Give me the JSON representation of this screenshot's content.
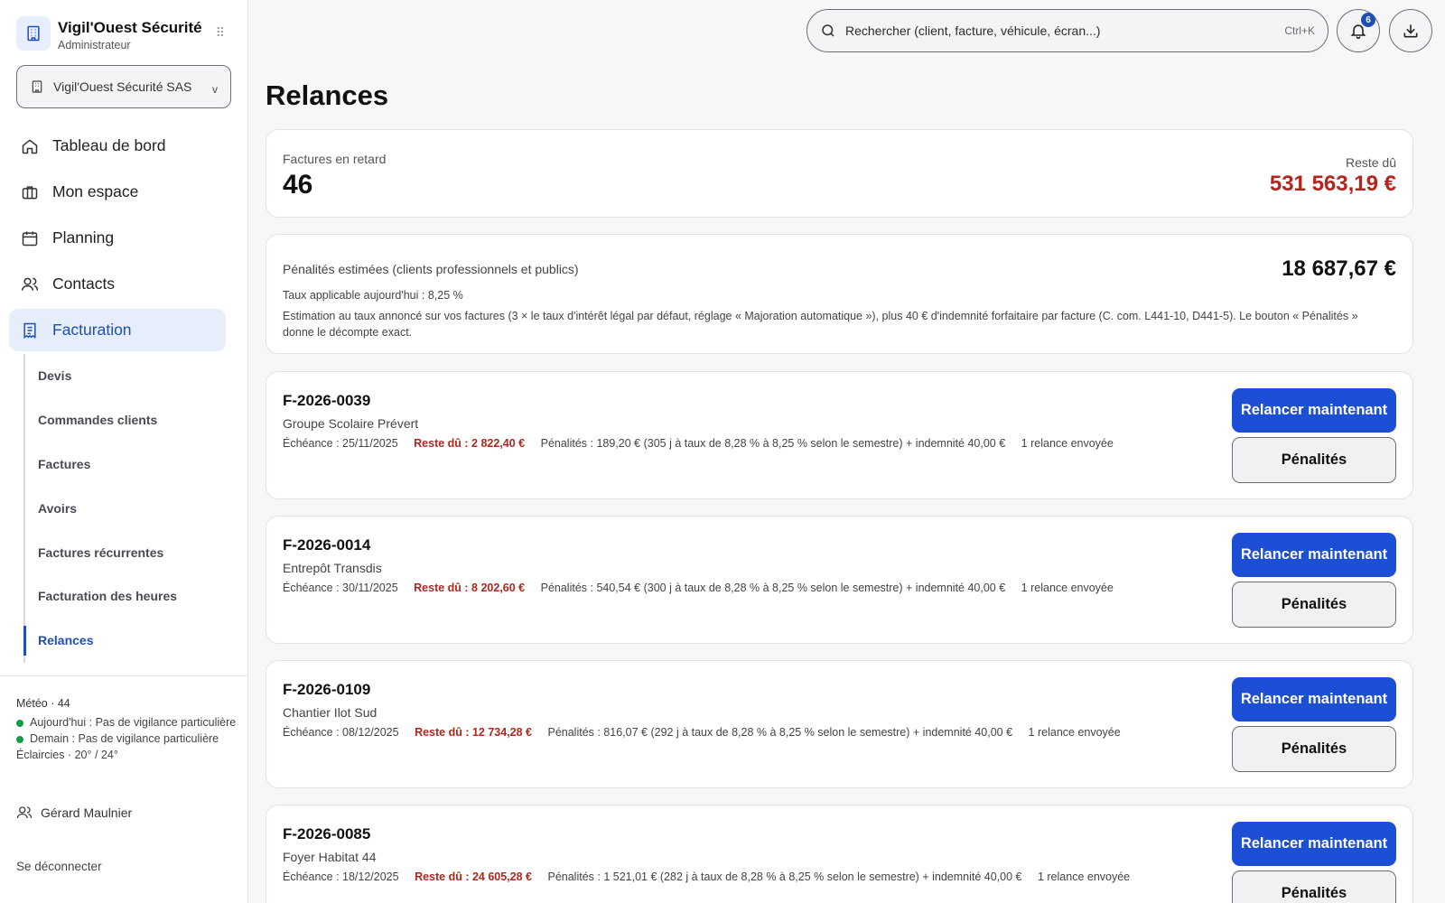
{
  "brand": {
    "name": "Vigil'Ouest Sécurité",
    "role": "Administrateur"
  },
  "org_select": {
    "value": "Vigil'Ouest Sécurité SAS",
    "chevron": "v"
  },
  "nav": [
    {
      "label": "Tableau de bord",
      "icon": "home-icon"
    },
    {
      "label": "Mon espace",
      "icon": "briefcase-icon"
    },
    {
      "label": "Planning",
      "icon": "calendar-icon"
    },
    {
      "label": "Contacts",
      "icon": "users-icon"
    },
    {
      "label": "Facturation",
      "icon": "receipt-icon",
      "active": true
    }
  ],
  "subnav": [
    {
      "label": "Devis"
    },
    {
      "label": "Commandes clients"
    },
    {
      "label": "Factures"
    },
    {
      "label": "Avoirs"
    },
    {
      "label": "Factures récurrentes"
    },
    {
      "label": "Facturation des heures"
    },
    {
      "label": "Relances",
      "active": true
    }
  ],
  "meteo": {
    "title": "Météo · 44",
    "today": "Aujourd'hui : Pas de vigilance particulière",
    "tomorrow": "Demain : Pas de vigilance particulière",
    "forecast": "Éclaircies · 20° / 24°"
  },
  "user": {
    "name": "Gérard Maulnier"
  },
  "logout": "Se déconnecter",
  "search": {
    "placeholder": "Rechercher (client, facture, véhicule, écran...)",
    "shortcut": "Ctrl+K"
  },
  "notifications": {
    "count": "6"
  },
  "page": {
    "title": "Relances"
  },
  "summary": {
    "label": "Factures en retard",
    "count": "46",
    "remaining_label": "Reste dû",
    "remaining_total": "531 563,19 €"
  },
  "penalties": {
    "title": "Pénalités estimées (clients professionnels et publics)",
    "total": "18 687,67 €",
    "rate": "Taux applicable aujourd'hui : 8,25 %",
    "note": "Estimation au taux annoncé sur vos factures (3 × le taux d'intérêt légal par défaut, réglage « Majoration automatique »), plus 40 € d'indemnité forfaitaire par facture (C. com. L441-10, D441-5). Le bouton « Pénalités » donne le décompte exact."
  },
  "invoices": [
    {
      "number": "F-2026-0039",
      "client": "Groupe Scolaire Prévert",
      "due_date": "Échéance : 25/11/2025",
      "remaining": "Reste dû : 2 822,40 €",
      "penalties": "Pénalités : 189,20 € (305 j à taux de 8,28 % à 8,25 % selon le semestre) + indemnité 40,00 €",
      "reminders": "1 relance envoyée"
    },
    {
      "number": "F-2026-0014",
      "client": "Entrepôt Transdis",
      "due_date": "Échéance : 30/11/2025",
      "remaining": "Reste dû : 8 202,60 €",
      "penalties": "Pénalités : 540,54 € (300 j à taux de 8,28 % à 8,25 % selon le semestre) + indemnité 40,00 €",
      "reminders": "1 relance envoyée"
    },
    {
      "number": "F-2026-0109",
      "client": "Chantier Ilot Sud",
      "due_date": "Échéance : 08/12/2025",
      "remaining": "Reste dû : 12 734,28 €",
      "penalties": "Pénalités : 816,07 € (292 j à taux de 8,28 % à 8,25 % selon le semestre) + indemnité 40,00 €",
      "reminders": "1 relance envoyée"
    },
    {
      "number": "F-2026-0085",
      "client": "Foyer Habitat 44",
      "due_date": "Échéance : 18/12/2025",
      "remaining": "Reste dû : 24 605,28 €",
      "penalties": "Pénalités : 1 521,01 € (282 j à taux de 8,28 % à 8,25 % selon le semestre) + indemnité 40,00 €",
      "reminders": "1 relance envoyée"
    }
  ],
  "actions": {
    "remind_now": "Relancer maintenant",
    "penalties": "Pénalités"
  },
  "colors": {
    "accent": "#1d4fd6",
    "active_nav_bg": "#e6edfb",
    "due_red": "#b3261e",
    "weather_dot": "#17994a"
  }
}
